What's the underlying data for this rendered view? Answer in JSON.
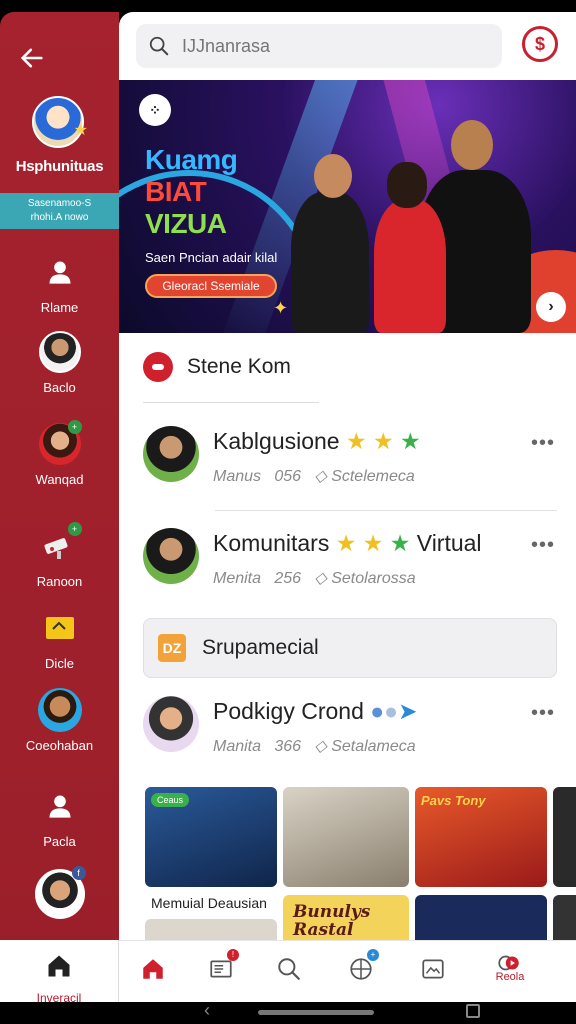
{
  "sidebar": {
    "brand_name": "Hsphunituas",
    "brand_tagline_1": "Sasenamoo-S",
    "brand_tagline_2": "rhohi.A nowo",
    "items": [
      {
        "label": "Rlame",
        "icon": "person-icon"
      },
      {
        "label": "Baclo",
        "icon": "avatar"
      },
      {
        "label": "Wanqad",
        "icon": "avatar"
      },
      {
        "label": "Ranoon",
        "icon": "camera-icon"
      },
      {
        "label": "Dicle",
        "icon": "ticket-icon"
      },
      {
        "label": "Coeohaban",
        "icon": "avatar"
      },
      {
        "label": "Pacla",
        "icon": "person-icon"
      }
    ],
    "home_label": "Inveracil"
  },
  "search": {
    "placeholder": "IJJnanrasa"
  },
  "hero": {
    "title_1": "Kuamg",
    "title_2": "BIAT",
    "title_3": "VIZUA",
    "subtitle": "Saen Pncian adair kilal",
    "cta": "Gleoracl Ssemiale"
  },
  "section": {
    "title": "Stene Kom"
  },
  "rows": [
    {
      "name": "Kablgusione",
      "suffix": "",
      "meta_1": "Manus",
      "meta_2": "056",
      "meta_3": "Sctelemeca"
    },
    {
      "name": "Komunitars",
      "suffix": "Virtual",
      "meta_1": "Menita",
      "meta_2": "256",
      "meta_3": "Setolarossa"
    },
    {
      "name": "Podkigy Crond",
      "suffix": "",
      "meta_1": "Manita",
      "meta_2": "366",
      "meta_3": "Setalameca"
    }
  ],
  "special": {
    "icon_text": "DZ",
    "label": "Srupamecial"
  },
  "thumbs": {
    "caption": "Memuial Deausian",
    "card_text_1": "Bunulys",
    "card_text_2": "Rastal",
    "card_text_3": "Pavs Tony",
    "tag": "Ceaus"
  },
  "tabbar": {
    "active_label": "Reola"
  },
  "colors": {
    "sidebar_red": "#a5222e",
    "accent_red": "#c8202e",
    "teal": "#3ba7b4"
  }
}
